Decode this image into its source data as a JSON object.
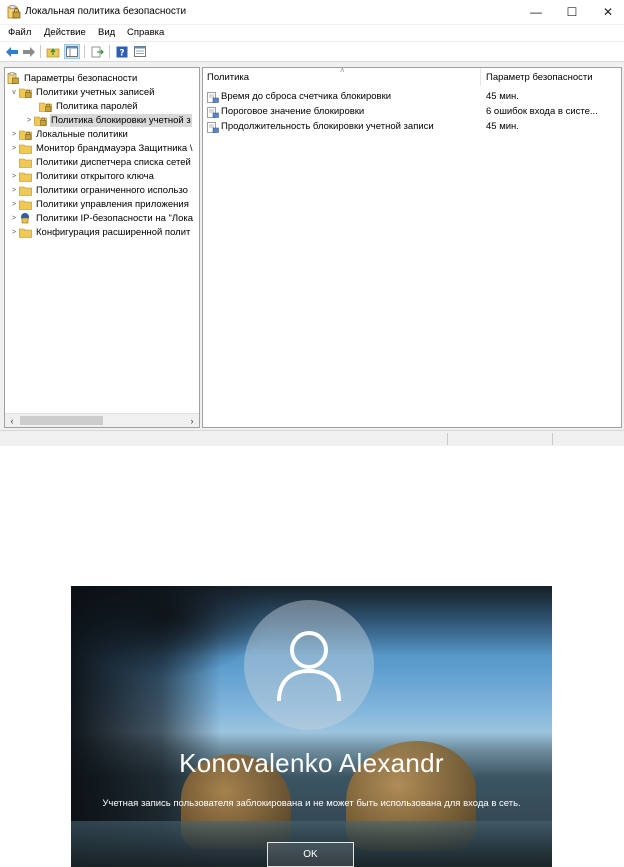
{
  "window": {
    "title": "Локальная политика безопасности",
    "icon": "security-policy-icon",
    "controls": {
      "minimize": "—",
      "maximize": "☐",
      "close": "✕"
    }
  },
  "menu": [
    "Файл",
    "Действие",
    "Вид",
    "Справка"
  ],
  "toolbar": [
    "back-arrow-icon",
    "forward-arrow-icon",
    "up-folder-icon",
    "show-hide-tree-icon",
    "export-list-icon",
    "help-icon",
    "properties-icon"
  ],
  "tree": [
    {
      "label": "Параметры безопасности",
      "level": 0,
      "expander": "",
      "icon": "security-settings-icon"
    },
    {
      "label": "Политики учетных записей",
      "level": 1,
      "expander": "v",
      "icon": "folder-lock-icon"
    },
    {
      "label": "Политика паролей",
      "level": 2,
      "expander": "",
      "icon": "folder-lock-icon"
    },
    {
      "label": "Политика блокировки учетной з",
      "level": 2,
      "expander": ">",
      "icon": "folder-lock-icon",
      "selected": true
    },
    {
      "label": "Локальные политики",
      "level": 1,
      "expander": ">",
      "icon": "folder-lock-icon"
    },
    {
      "label": "Монитор брандмауэра Защитника \\",
      "level": 1,
      "expander": ">",
      "icon": "folder-icon"
    },
    {
      "label": "Политики диспетчера списка сетей",
      "level": 1,
      "expander": "",
      "icon": "folder-icon"
    },
    {
      "label": "Политики открытого ключа",
      "level": 1,
      "expander": ">",
      "icon": "folder-icon"
    },
    {
      "label": "Политики ограниченного использо",
      "level": 1,
      "expander": ">",
      "icon": "folder-icon"
    },
    {
      "label": "Политики управления приложения",
      "level": 1,
      "expander": ">",
      "icon": "folder-icon"
    },
    {
      "label": "Политики IP-безопасности на \"Лока",
      "level": 1,
      "expander": ">",
      "icon": "ipsec-icon"
    },
    {
      "label": "Конфигурация расширенной полит",
      "level": 1,
      "expander": ">",
      "icon": "folder-icon"
    }
  ],
  "list": {
    "columns": [
      "Политика",
      "Параметр безопасности"
    ],
    "rows": [
      {
        "name": "Время до сброса счетчика блокировки",
        "value": "45 мин."
      },
      {
        "name": "Пороговое значение блокировки",
        "value": "6 ошибок входа в систе..."
      },
      {
        "name": "Продолжительность блокировки учетной записи",
        "value": "45 мин."
      }
    ]
  },
  "lock_screen": {
    "user_name": "Konovalenko Alexandr",
    "message": "Учетная запись пользователя заблокирована и не может быть использована для входа в сеть.",
    "ok_label": "OK"
  }
}
